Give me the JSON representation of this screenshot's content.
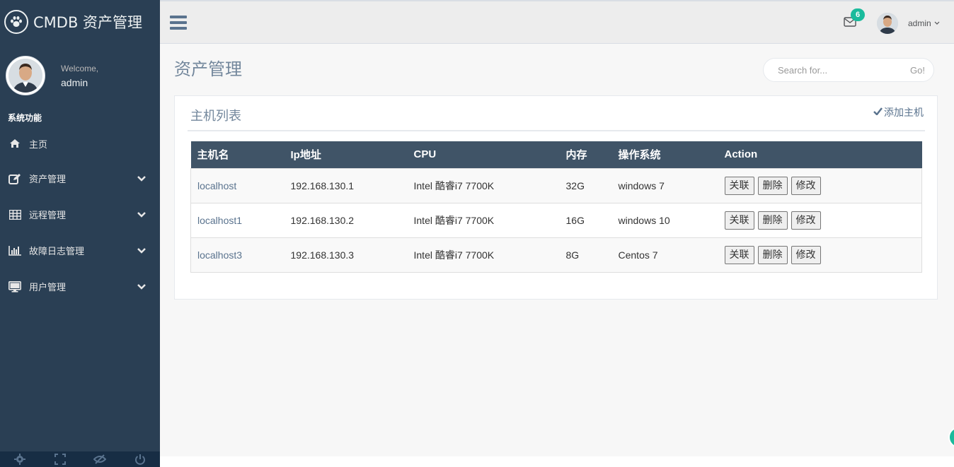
{
  "brand": {
    "title": "CMDB 资产管理",
    "logo_icon": "paw-icon"
  },
  "profile": {
    "welcome": "Welcome,",
    "name": "admin"
  },
  "sidebar": {
    "section_title": "系统功能",
    "items": [
      {
        "label": "主页",
        "icon": "home-icon"
      },
      {
        "label": "资产管理",
        "icon": "edit-icon"
      },
      {
        "label": "远程管理",
        "icon": "table-icon"
      },
      {
        "label": "故障日志管理",
        "icon": "bar-chart-icon"
      },
      {
        "label": "用户管理",
        "icon": "desktop-icon"
      }
    ],
    "footer_icons": [
      "gear-icon",
      "fullscreen-icon",
      "eye-slash-icon",
      "power-icon"
    ]
  },
  "topnav": {
    "mail_count": "6",
    "user_name": "admin"
  },
  "page": {
    "title": "资产管理",
    "search": {
      "placeholder": "Search for...",
      "button": "Go!"
    }
  },
  "panel": {
    "title": "主机列表",
    "add_label": "添加主机"
  },
  "table": {
    "headers": [
      "主机名",
      "Ip地址",
      "CPU",
      "内存",
      "操作系统",
      "Action"
    ],
    "rows": [
      {
        "host": "localhost",
        "ip": "192.168.130.1",
        "cpu": "Intel 酷睿i7 7700K",
        "mem": "32G",
        "os": "windows 7"
      },
      {
        "host": "localhost1",
        "ip": "192.168.130.2",
        "cpu": "Intel 酷睿i7 7700K",
        "mem": "16G",
        "os": "windows 10"
      },
      {
        "host": "localhost3",
        "ip": "192.168.130.3",
        "cpu": "Intel 酷睿i7 7700K",
        "mem": "8G",
        "os": "Centos 7"
      }
    ],
    "actions": {
      "link": "关联",
      "delete": "删除",
      "edit": "修改"
    }
  },
  "colors": {
    "sidebar": "#2a3f54",
    "accent": "#1abb9c",
    "table_header": "#405467"
  }
}
